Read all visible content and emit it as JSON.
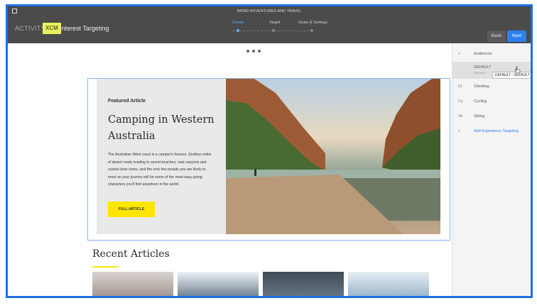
{
  "window": {
    "title": "WKND ADVENTURES AND TRAVEL"
  },
  "header": {
    "activity_label": "ACTIVITY:",
    "activity_badge": "XCM",
    "activity_name": "Interest Targeting",
    "steps": [
      "Create",
      "Target",
      "Goals & Settings"
    ],
    "active_step": "Create",
    "back_label": "Back",
    "next_label": "Next"
  },
  "feature": {
    "kicker": "Featured Article",
    "title": "Camping in Western Australia",
    "body": "The Australian West coast is a camper's heaven. Endless miles of desert roads leading to secret beaches, vast canyons and crystal clear rivers, and the very few people you are likely to meet on your journey will be some of the most easy-going characters you'll find anywhere in the world.",
    "button_label": "FULL ARTICLE"
  },
  "recent": {
    "title": "Recent Articles"
  },
  "panel": {
    "collapse_glyph": ">",
    "header_label": "Audiences",
    "items": [
      {
        "key": "",
        "label": "DEFAULT",
        "sublabel": "DEFAULT"
      },
      {
        "key": "Cl",
        "label": "Climbing"
      },
      {
        "key": "Cy",
        "label": "Cycling"
      },
      {
        "key": "Sk",
        "label": "Skiing"
      },
      {
        "key": "+",
        "label": "Add Experience Targeting"
      }
    ],
    "tooltip": "DEFAULT - DEFAULT"
  },
  "colors": {
    "accent": "#2e7ef0",
    "brand_yellow": "#ffe600",
    "header_bg": "#4b4b4b"
  }
}
